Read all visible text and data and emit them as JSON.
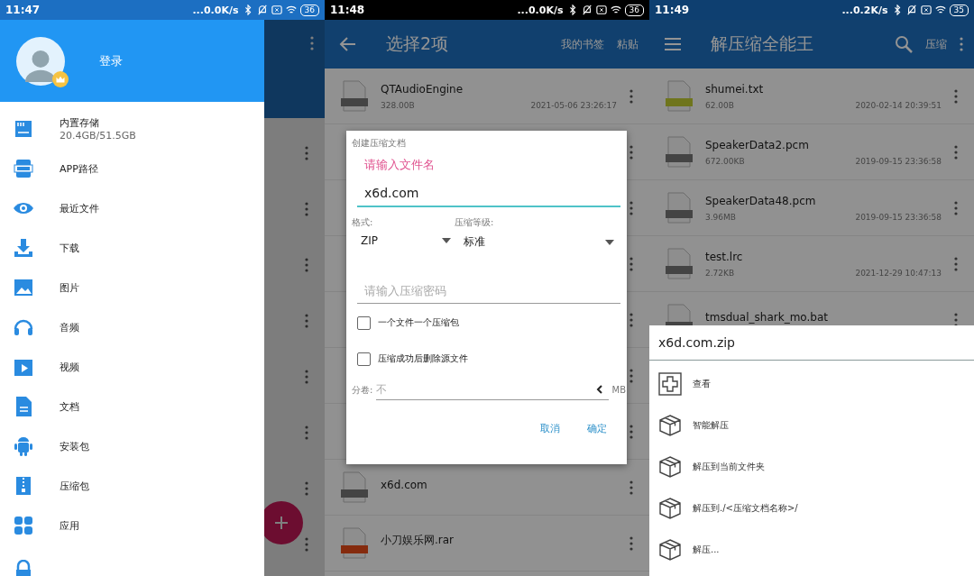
{
  "drawer_screen": {
    "status_bar": {
      "time": "11:47",
      "speed": "...0.0K/s",
      "battery": "36"
    },
    "drawer": {
      "login": "登录",
      "items": [
        {
          "kind": "storage",
          "label": "内置存储",
          "detail": "20.4GB/51.5GB"
        },
        {
          "kind": "app",
          "label": "APP路径"
        },
        {
          "kind": "eye",
          "label": "最近文件"
        },
        {
          "kind": "download",
          "label": "下载"
        },
        {
          "kind": "image",
          "label": "图片"
        },
        {
          "kind": "audio",
          "label": "音频"
        },
        {
          "kind": "video",
          "label": "视频"
        },
        {
          "kind": "document",
          "label": "文档"
        },
        {
          "kind": "android",
          "label": "安装包"
        },
        {
          "kind": "zip",
          "label": "压缩包"
        },
        {
          "kind": "apps",
          "label": "应用"
        }
      ]
    }
  },
  "dialog_screen": {
    "status_bar": {
      "time": "11:48",
      "speed": "...0.0K/s",
      "battery": "36"
    },
    "app_bar": {
      "title": "选择2项",
      "actions": [
        "我的书签",
        "粘贴"
      ]
    },
    "files_top": [
      {
        "name": "QTAudioEngine",
        "size": "328.00B",
        "date": "2021-05-06 23:26:17",
        "kind": "generic"
      }
    ],
    "files_bottom": [
      {
        "name": "x6d.com",
        "kind": "generic"
      },
      {
        "name": "小刀娱乐网.rar",
        "kind": "archive"
      }
    ],
    "dialog": {
      "title": "创建压缩文档",
      "name_label": "请输入文件名",
      "name_value": "x6d.com",
      "format_label": "格式:",
      "format_value": "ZIP",
      "level_label": "压缩等级:",
      "level_value": "标准",
      "password_placeholder": "请输入压缩密码",
      "options": [
        {
          "label": "一个文件一个压缩包",
          "checked": false
        },
        {
          "label": "压缩成功后删除源文件",
          "checked": false
        }
      ],
      "split_label": "分卷:",
      "split_placeholder": "不",
      "split_unit": "MB",
      "buttons": [
        "取消",
        "确定"
      ]
    }
  },
  "sheet_screen": {
    "status_bar": {
      "time": "11:49",
      "speed": "...0.2K/s",
      "battery": "35"
    },
    "app_bar": {
      "title": "解压缩全能王",
      "action": "压缩"
    },
    "files": [
      {
        "name": "shumei.txt",
        "size": "62.00B",
        "date": "2020-02-14 20:39:51",
        "kind": "text"
      },
      {
        "name": "SpeakerData2.pcm",
        "size": "672.00KB",
        "date": "2019-09-15 23:36:58",
        "kind": "generic"
      },
      {
        "name": "SpeakerData48.pcm",
        "size": "3.96MB",
        "date": "2019-09-15 23:36:58",
        "kind": "generic"
      },
      {
        "name": "test.lrc",
        "size": "2.72KB",
        "date": "2021-12-29 10:47:13",
        "kind": "generic"
      },
      {
        "name": "tmsdual_shark_mo.bat",
        "kind": "generic"
      }
    ],
    "sheet": {
      "title": "x6d.com.zip",
      "items": [
        {
          "kind": "view",
          "label": "查看"
        },
        {
          "kind": "extract",
          "label": "智能解压"
        },
        {
          "kind": "extract",
          "label": "解压到当前文件夹"
        },
        {
          "kind": "extract",
          "label": "解压到./<压缩文档名称>/"
        },
        {
          "kind": "extract",
          "label": "解压..."
        }
      ]
    }
  }
}
